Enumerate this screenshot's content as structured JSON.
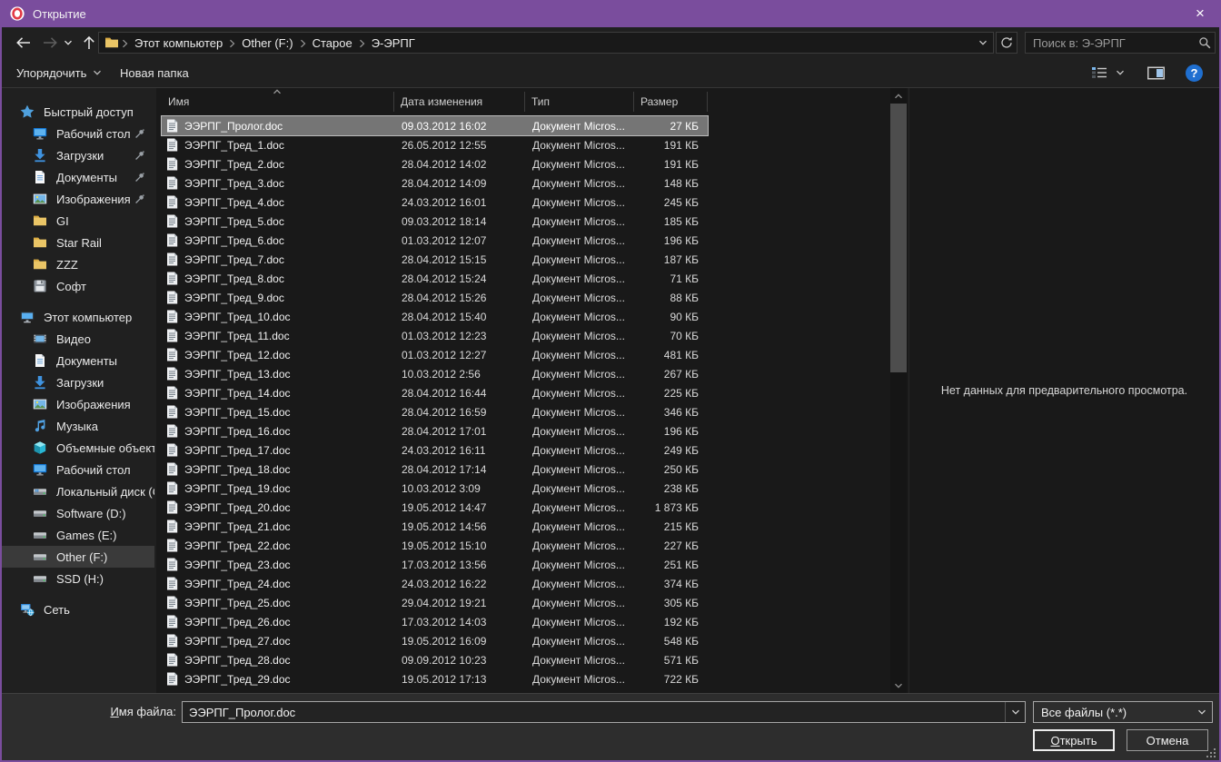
{
  "window": {
    "title": "Открытие"
  },
  "titlebar": {
    "close_glyph": "×"
  },
  "navbar": {
    "breadcrumb": [
      "Этот компьютер",
      "Other (F:)",
      "Старое",
      "Э-ЭРПГ"
    ],
    "search_placeholder": "Поиск в: Э-ЭРПГ"
  },
  "toolbar": {
    "organize_label": "Упорядочить",
    "new_folder_label": "Новая папка",
    "help_glyph": "?"
  },
  "sidebar": {
    "sections": [
      {
        "label": "Быстрый доступ",
        "icon": "star",
        "children": [
          {
            "label": "Рабочий стол",
            "icon": "desktop",
            "pinned": true
          },
          {
            "label": "Загрузки",
            "icon": "downloads",
            "pinned": true
          },
          {
            "label": "Документы",
            "icon": "document",
            "pinned": true
          },
          {
            "label": "Изображения",
            "icon": "pictures",
            "pinned": true
          },
          {
            "label": "GI",
            "icon": "folder"
          },
          {
            "label": "Star Rail",
            "icon": "folder"
          },
          {
            "label": "ZZZ",
            "icon": "folder"
          },
          {
            "label": "Софт",
            "icon": "disk"
          }
        ]
      },
      {
        "label": "Этот компьютер",
        "icon": "computer",
        "children": [
          {
            "label": "Видео",
            "icon": "video"
          },
          {
            "label": "Документы",
            "icon": "document"
          },
          {
            "label": "Загрузки",
            "icon": "downloads"
          },
          {
            "label": "Изображения",
            "icon": "pictures"
          },
          {
            "label": "Музыка",
            "icon": "music"
          },
          {
            "label": "Объемные объекты",
            "icon": "cube"
          },
          {
            "label": "Рабочий стол",
            "icon": "desktop"
          },
          {
            "label": "Локальный диск (C:)",
            "icon": "drive-win"
          },
          {
            "label": "Software (D:)",
            "icon": "drive"
          },
          {
            "label": "Games (E:)",
            "icon": "drive"
          },
          {
            "label": "Other (F:)",
            "icon": "drive",
            "selected": true
          },
          {
            "label": "SSD (H:)",
            "icon": "drive"
          }
        ]
      },
      {
        "label": "Сеть",
        "icon": "network",
        "children": []
      }
    ]
  },
  "filelist": {
    "columns": [
      "Имя",
      "Дата изменения",
      "Тип",
      "Размер"
    ],
    "rows": [
      {
        "name": "ЭЭРПГ_Пролог.doc",
        "date": "09.03.2012 16:02",
        "type": "Документ Micros...",
        "size": "27 КБ",
        "selected": true
      },
      {
        "name": "ЭЭРПГ_Тред_1.doc",
        "date": "26.05.2012 12:55",
        "type": "Документ Micros...",
        "size": "191 КБ"
      },
      {
        "name": "ЭЭРПГ_Тред_2.doc",
        "date": "28.04.2012 14:02",
        "type": "Документ Micros...",
        "size": "191 КБ"
      },
      {
        "name": "ЭЭРПГ_Тред_3.doc",
        "date": "28.04.2012 14:09",
        "type": "Документ Micros...",
        "size": "148 КБ"
      },
      {
        "name": "ЭЭРПГ_Тред_4.doc",
        "date": "24.03.2012 16:01",
        "type": "Документ Micros...",
        "size": "245 КБ"
      },
      {
        "name": "ЭЭРПГ_Тред_5.doc",
        "date": "09.03.2012 18:14",
        "type": "Документ Micros...",
        "size": "185 КБ"
      },
      {
        "name": "ЭЭРПГ_Тред_6.doc",
        "date": "01.03.2012 12:07",
        "type": "Документ Micros...",
        "size": "196 КБ"
      },
      {
        "name": "ЭЭРПГ_Тред_7.doc",
        "date": "28.04.2012 15:15",
        "type": "Документ Micros...",
        "size": "187 КБ"
      },
      {
        "name": "ЭЭРПГ_Тред_8.doc",
        "date": "28.04.2012 15:24",
        "type": "Документ Micros...",
        "size": "71 КБ"
      },
      {
        "name": "ЭЭРПГ_Тред_9.doc",
        "date": "28.04.2012 15:26",
        "type": "Документ Micros...",
        "size": "88 КБ"
      },
      {
        "name": "ЭЭРПГ_Тред_10.doc",
        "date": "28.04.2012 15:40",
        "type": "Документ Micros...",
        "size": "90 КБ"
      },
      {
        "name": "ЭЭРПГ_Тред_11.doc",
        "date": "01.03.2012 12:23",
        "type": "Документ Micros...",
        "size": "70 КБ"
      },
      {
        "name": "ЭЭРПГ_Тред_12.doc",
        "date": "01.03.2012 12:27",
        "type": "Документ Micros...",
        "size": "481 КБ"
      },
      {
        "name": "ЭЭРПГ_Тред_13.doc",
        "date": "10.03.2012 2:56",
        "type": "Документ Micros...",
        "size": "267 КБ"
      },
      {
        "name": "ЭЭРПГ_Тред_14.doc",
        "date": "28.04.2012 16:44",
        "type": "Документ Micros...",
        "size": "225 КБ"
      },
      {
        "name": "ЭЭРПГ_Тред_15.doc",
        "date": "28.04.2012 16:59",
        "type": "Документ Micros...",
        "size": "346 КБ"
      },
      {
        "name": "ЭЭРПГ_Тред_16.doc",
        "date": "28.04.2012 17:01",
        "type": "Документ Micros...",
        "size": "196 КБ"
      },
      {
        "name": "ЭЭРПГ_Тред_17.doc",
        "date": "24.03.2012 16:11",
        "type": "Документ Micros...",
        "size": "249 КБ"
      },
      {
        "name": "ЭЭРПГ_Тред_18.doc",
        "date": "28.04.2012 17:14",
        "type": "Документ Micros...",
        "size": "250 КБ"
      },
      {
        "name": "ЭЭРПГ_Тред_19.doc",
        "date": "10.03.2012 3:09",
        "type": "Документ Micros...",
        "size": "238 КБ"
      },
      {
        "name": "ЭЭРПГ_Тред_20.doc",
        "date": "19.05.2012 14:47",
        "type": "Документ Micros...",
        "size": "1 873 КБ"
      },
      {
        "name": "ЭЭРПГ_Тред_21.doc",
        "date": "19.05.2012 14:56",
        "type": "Документ Micros...",
        "size": "215 КБ"
      },
      {
        "name": "ЭЭРПГ_Тред_22.doc",
        "date": "19.05.2012 15:10",
        "type": "Документ Micros...",
        "size": "227 КБ"
      },
      {
        "name": "ЭЭРПГ_Тред_23.doc",
        "date": "17.03.2012 13:56",
        "type": "Документ Micros...",
        "size": "251 КБ"
      },
      {
        "name": "ЭЭРПГ_Тред_24.doc",
        "date": "24.03.2012 16:22",
        "type": "Документ Micros...",
        "size": "374 КБ"
      },
      {
        "name": "ЭЭРПГ_Тред_25.doc",
        "date": "29.04.2012 19:21",
        "type": "Документ Micros...",
        "size": "305 КБ"
      },
      {
        "name": "ЭЭРПГ_Тред_26.doc",
        "date": "17.03.2012 14:03",
        "type": "Документ Micros...",
        "size": "192 КБ"
      },
      {
        "name": "ЭЭРПГ_Тред_27.doc",
        "date": "19.05.2012 16:09",
        "type": "Документ Micros...",
        "size": "548 КБ"
      },
      {
        "name": "ЭЭРПГ_Тред_28.doc",
        "date": "09.09.2012 10:23",
        "type": "Документ Micros...",
        "size": "571 КБ"
      },
      {
        "name": "ЭЭРПГ_Тред_29.doc",
        "date": "19.05.2012 17:13",
        "type": "Документ Micros...",
        "size": "722 КБ"
      }
    ]
  },
  "preview": {
    "empty_text": "Нет данных для предварительного просмотра."
  },
  "footer": {
    "filename_label_accel": "И",
    "filename_label_rest": "мя файла:",
    "filename_value": "ЭЭРПГ_Пролог.doc",
    "filetype_value": "Все файлы (*.*)",
    "open_accel": "О",
    "open_rest": "ткрыть",
    "cancel_label": "Отмена"
  },
  "colors": {
    "accent_purple": "#7a4d9d",
    "help_blue": "#1f6fd0",
    "selection_gray": "#757575",
    "folder_yellow": "#eac566"
  }
}
